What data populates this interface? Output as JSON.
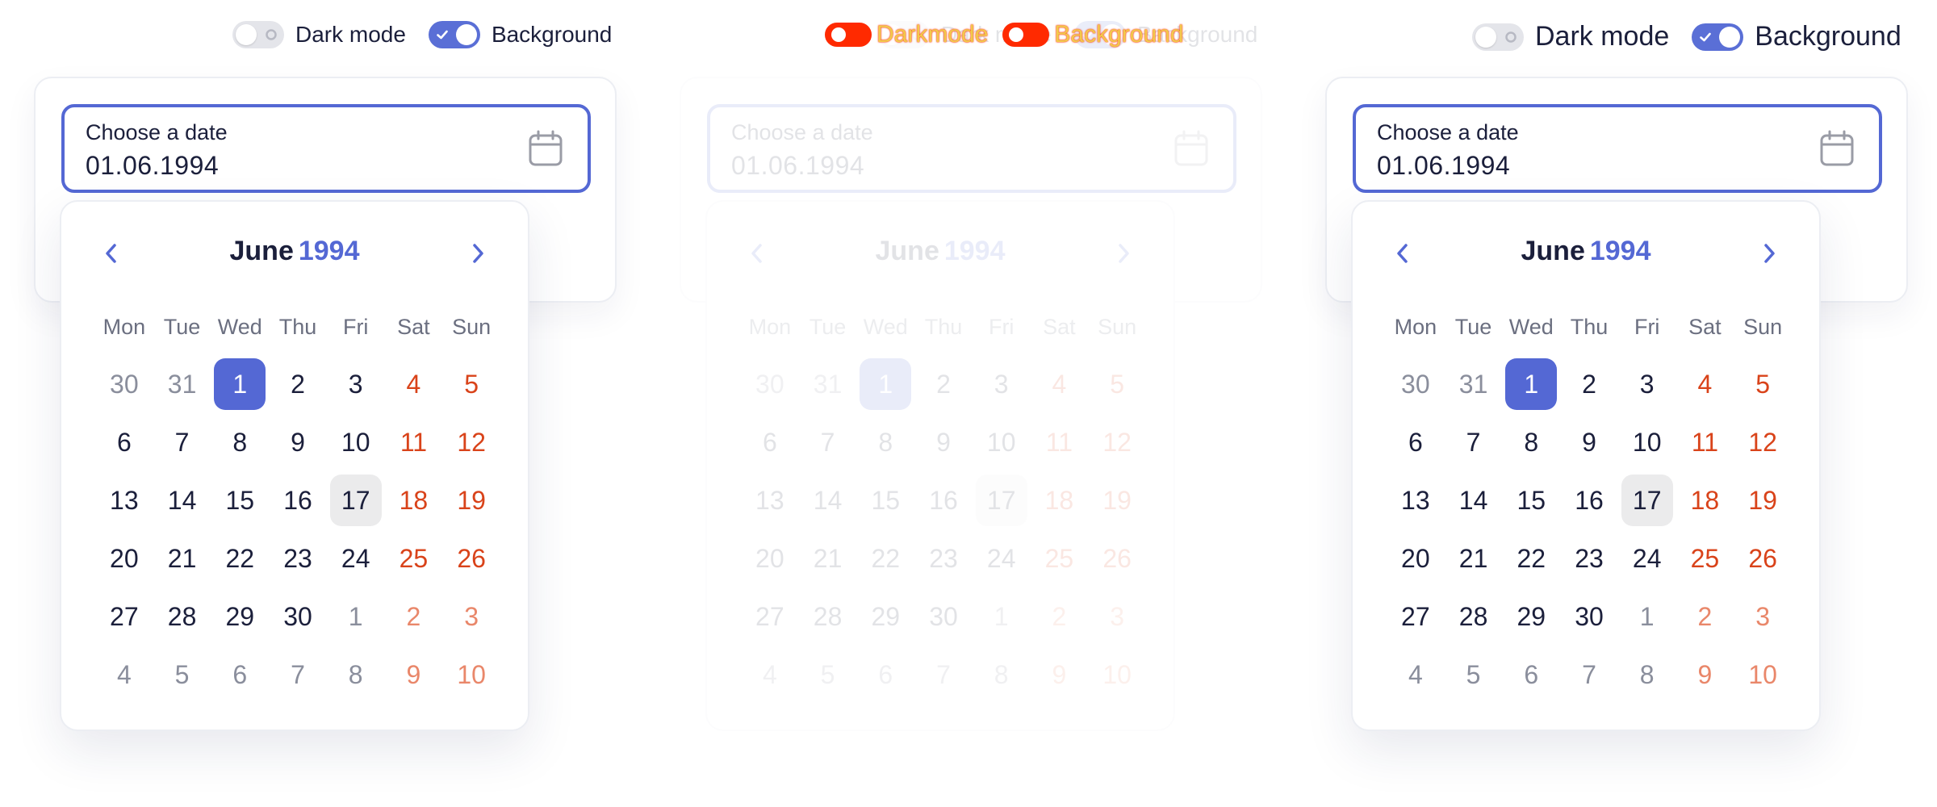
{
  "toggles": {
    "dark_mode_label": "Dark mode",
    "background_label": "Background",
    "dark_mode_on": false,
    "background_on": true
  },
  "overlay": {
    "dark_mode_label": "Darkmode",
    "background_label": "Background",
    "dark_mode_small": "Dark mode",
    "background_small": "Background"
  },
  "date_field": {
    "label": "Choose a date",
    "value": "01.06.1994",
    "icon": "calendar-icon"
  },
  "calendar": {
    "month": "June",
    "year": "1994",
    "prev_icon": "chevron-left-icon",
    "next_icon": "chevron-right-icon",
    "weekdays": [
      "Mon",
      "Tue",
      "Wed",
      "Thu",
      "Fri",
      "Sat",
      "Sun"
    ],
    "selected_day": "1",
    "highlighted_day": "17",
    "weeks": [
      [
        "30",
        "31",
        "1",
        "2",
        "3",
        "4",
        "5"
      ],
      [
        "6",
        "7",
        "8",
        "9",
        "10",
        "11",
        "12"
      ],
      [
        "13",
        "14",
        "15",
        "16",
        "17",
        "18",
        "19"
      ],
      [
        "20",
        "21",
        "22",
        "23",
        "24",
        "25",
        "26"
      ],
      [
        "27",
        "28",
        "29",
        "30",
        "1",
        "2",
        "3"
      ],
      [
        "4",
        "5",
        "6",
        "7",
        "8",
        "9",
        "10"
      ]
    ]
  },
  "colors": {
    "accent": "#5468d4",
    "weekend": "#d9431a",
    "text": "#1b1f3b"
  }
}
